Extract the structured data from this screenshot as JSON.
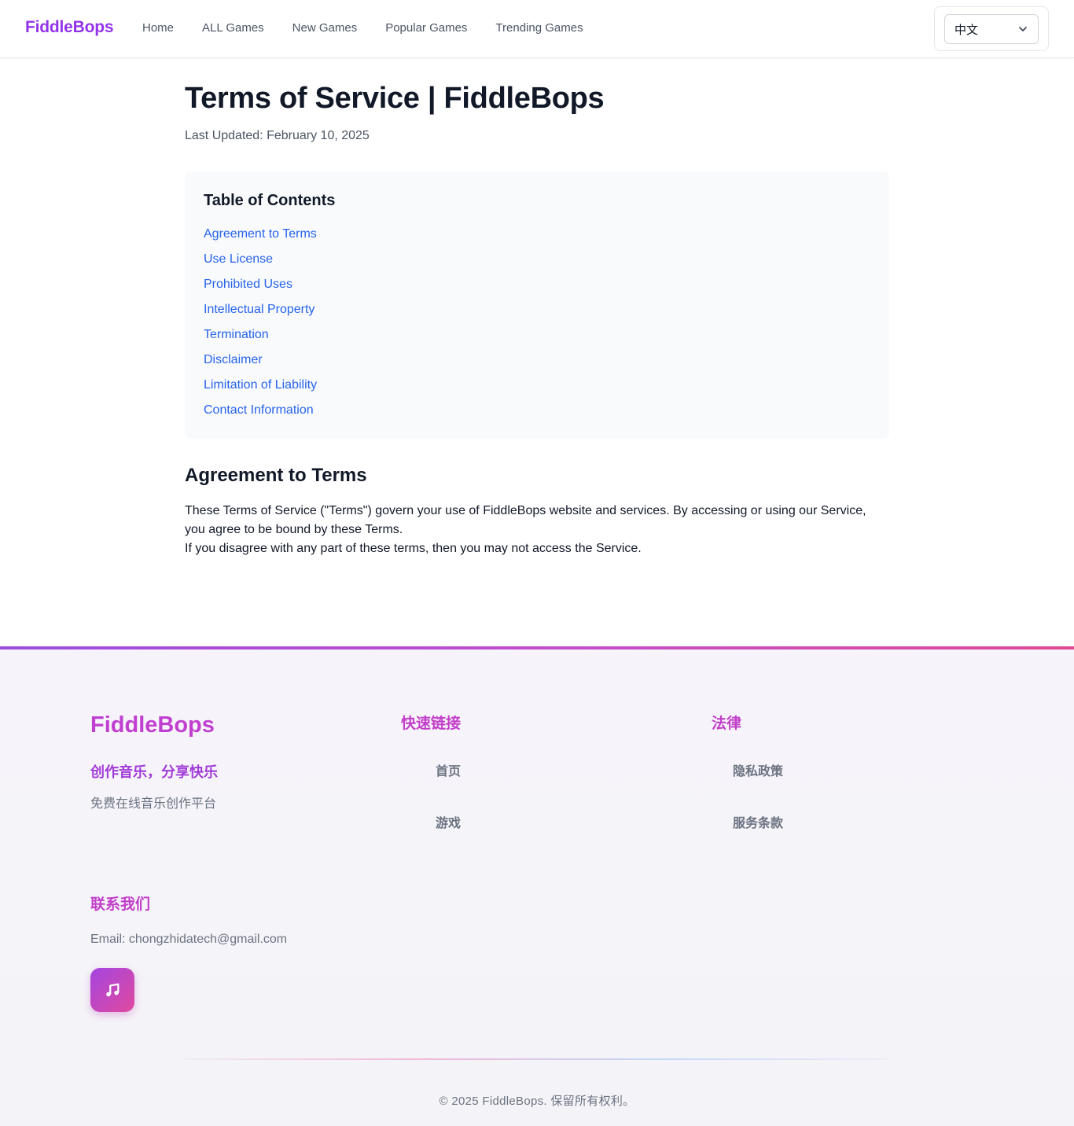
{
  "header": {
    "logo": "FiddleBops",
    "nav": [
      "Home",
      "ALL Games",
      "New Games",
      "Popular Games",
      "Trending Games"
    ],
    "language": "中文"
  },
  "main": {
    "title": "Terms of Service | FiddleBops",
    "last_updated": "Last Updated: February 10, 2025",
    "toc": {
      "title": "Table of Contents",
      "items": [
        "Agreement to Terms",
        "Use License",
        "Prohibited Uses",
        "Intellectual Property",
        "Termination",
        "Disclaimer",
        "Limitation of Liability",
        "Contact Information"
      ]
    },
    "section": {
      "title": "Agreement to Terms",
      "paragraph1": "These Terms of Service (\"Terms\") govern your use of FiddleBops website and services. By accessing or using our Service, you agree to be bound by these Terms.",
      "paragraph2": "If you disagree with any part of these terms, then you may not access the Service."
    }
  },
  "footer": {
    "logo": "FiddleBops",
    "tagline": "创作音乐，分享快乐",
    "description": "免费在线音乐创作平台",
    "quick_links": {
      "title": "快速链接",
      "items": [
        "首页",
        "游戏"
      ]
    },
    "legal": {
      "title": "法律",
      "items": [
        "隐私政策",
        "服务条款"
      ]
    },
    "contact": {
      "title": "联系我们",
      "email": "Email: chongzhidatech@gmail.com",
      "icon": "music-note-icon"
    },
    "copyright": "© 2025 FiddleBops. 保留所有权利。"
  },
  "colors": {
    "brand_purple": "#9333ea",
    "link_blue": "#2563eb",
    "footer_accent": "#c23ec9"
  }
}
